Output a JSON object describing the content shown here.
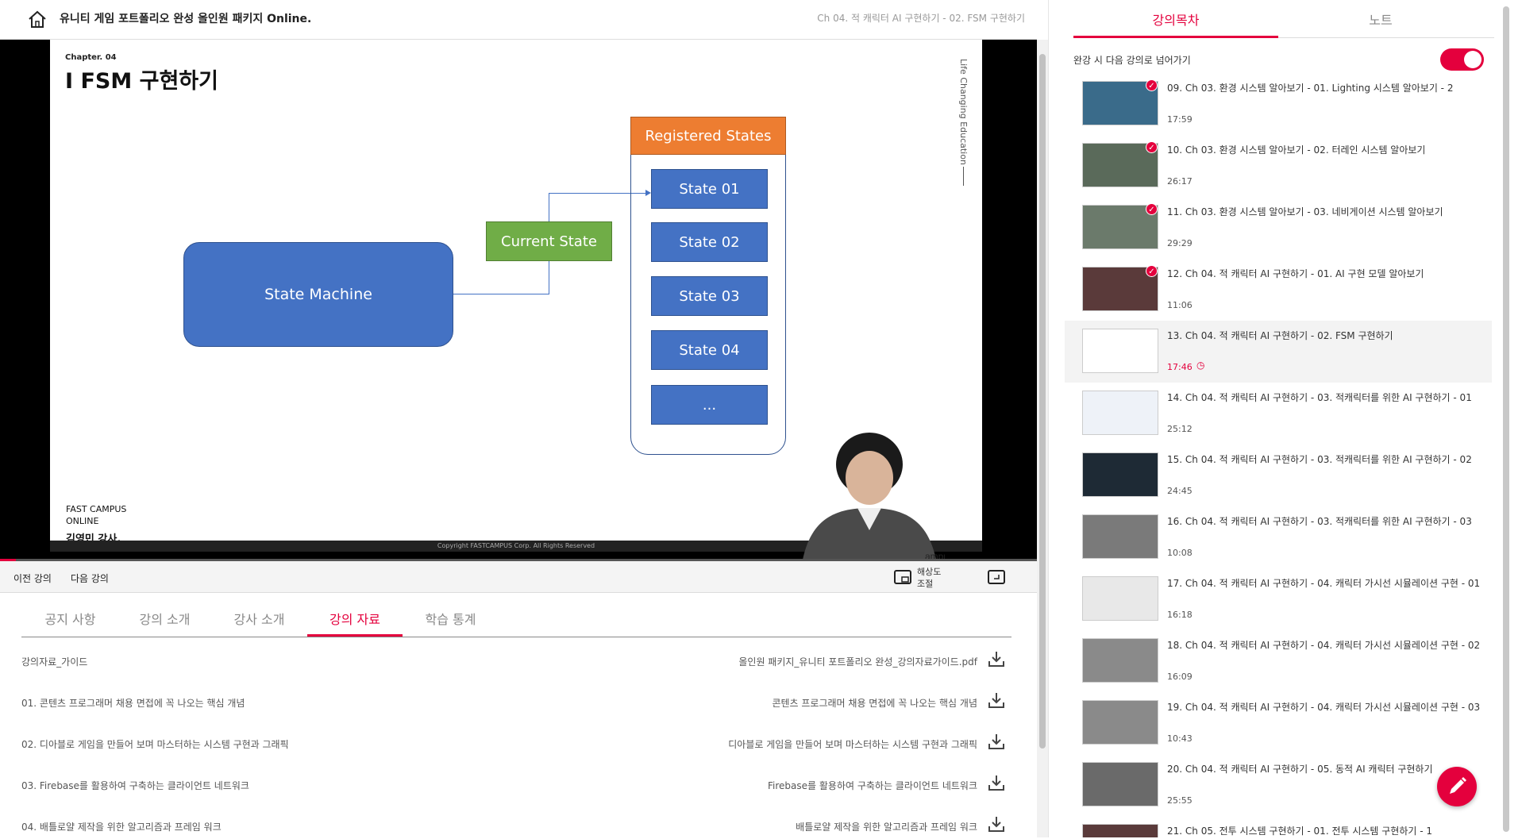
{
  "header": {
    "course_title": "유니티 게임 포트폴리오 완성 올인원 패키지 Online.",
    "breadcrumb": "Ch 04. 적 캐릭터 AI 구현하기 - 02. FSM 구현하기"
  },
  "slide": {
    "chapter": "Chapter.   04",
    "title": "I FSM 구현하기",
    "vertical_text": "Life Changing Education",
    "logo_line1": "FAST CAMPUS",
    "logo_line2": "ONLINE",
    "instructor": "김영민 강사.",
    "copyright": "Copyright FASTCAMPUS Corp. All Rights Reserved",
    "diagram": {
      "state_machine": "State Machine",
      "current_state": "Current State",
      "registered_states": "Registered States",
      "states": [
        "State 01",
        "State 02",
        "State 03",
        "State 04",
        "..."
      ]
    },
    "watermark": "fast campus"
  },
  "controls": {
    "prev": "이전 강의",
    "next": "다음 강의",
    "resolution": "해상도 조절",
    "resolution_line1": "해상도",
    "resolution_line2": "조절"
  },
  "tabs": [
    "공지 사항",
    "강의 소개",
    "강사 소개",
    "강의 자료",
    "학습 통계"
  ],
  "active_tab": "강의 자료",
  "materials": [
    {
      "left": "강의자료_가이드",
      "right": "올인원 패키지_유니티 포트폴리오 완성_강의자료가이드.pdf"
    },
    {
      "left": "01. 콘텐츠 프로그래머 채용 면접에 꼭 나오는 핵심 개념",
      "right": "콘텐츠 프로그래머 채용 면접에 꼭 나오는 핵심 개념"
    },
    {
      "left": "02. 디아블로 게임을 만들어 보며 마스터하는 시스템 구현과 그래픽",
      "right": "디아블로 게임을 만들어 보며 마스터하는 시스템 구현과 그래픽"
    },
    {
      "left": "03. Firebase를 활용하여 구축하는 클라이언트 네트워크",
      "right": "Firebase를 활용하여 구축하는 클라이언트 네트워크"
    },
    {
      "left": "04. 배틀로얄 제작을 위한 알고리즘과 프레임 워크",
      "right": "배틀로얄 제작을 위한 알고리즘과 프레임 워크"
    }
  ],
  "sidebar": {
    "tabs": [
      "강의목차",
      "노트"
    ],
    "auto_next_label": "완강 시 다음 강의로 넘어가기",
    "auto_next_on": true,
    "lectures": [
      {
        "title": "09. Ch 03. 환경 시스템 알아보기 - 01. Lighting 시스템 알아보기 - 2",
        "time": "17:59",
        "done": true
      },
      {
        "title": "10. Ch 03. 환경 시스템 알아보기 - 02. 터레인 시스템 알아보기",
        "time": "26:17",
        "done": true
      },
      {
        "title": "11. Ch 03. 환경 시스템 알아보기 - 03. 네비게이션 시스템 알아보기",
        "time": "29:29",
        "done": true
      },
      {
        "title": "12. Ch 04. 적 캐릭터 AI 구현하기 - 01. AI 구현 모델 알아보기",
        "time": "11:06",
        "done": true
      },
      {
        "title": "13. Ch 04. 적 캐릭터 AI 구현하기 - 02. FSM 구현하기",
        "time": "17:46",
        "done": false,
        "current": true
      },
      {
        "title": "14. Ch 04. 적 캐릭터 AI 구현하기 - 03. 적캐릭터를 위한 AI 구현하기 - 01",
        "time": "25:12",
        "done": false
      },
      {
        "title": "15. Ch 04. 적 캐릭터 AI 구현하기 - 03. 적캐릭터를 위한 AI 구현하기 - 02",
        "time": "24:45",
        "done": false
      },
      {
        "title": "16. Ch 04. 적 캐릭터 AI 구현하기 - 03. 적캐릭터를 위한 AI 구현하기 - 03",
        "time": "10:08",
        "done": false
      },
      {
        "title": "17. Ch 04. 적 캐릭터 AI 구현하기 - 04. 캐릭터 가시선 시뮬레이션 구현 - 01",
        "time": "16:18",
        "done": false
      },
      {
        "title": "18. Ch 04. 적 캐릭터 AI 구현하기 - 04. 캐릭터 가시선 시뮬레이션 구현 - 02",
        "time": "16:09",
        "done": false
      },
      {
        "title": "19. Ch 04. 적 캐릭터 AI 구현하기 - 04. 캐릭터 가시선 시뮬레이션 구현 - 03",
        "time": "10:43",
        "done": false
      },
      {
        "title": "20. Ch 04. 적 캐릭터 AI 구현하기 - 05. 동적 AI 캐릭터 구현하기",
        "time": "25:55",
        "done": false
      },
      {
        "title": "21. Ch 05. 전투 시스템 구현하기 - 01. 전투 시스템 구현하기 - 1",
        "time": "",
        "done": false
      }
    ]
  },
  "colors": {
    "accent": "#e4003d",
    "blue": "#4472c4",
    "green": "#70ad47",
    "orange": "#ed7d31"
  },
  "icons": {
    "home": "home-icon",
    "download": "download-icon",
    "pip": "pip-icon",
    "resolution": "resolution-icon",
    "pencil": "pencil-icon",
    "check": "check-icon",
    "clock": "clock-icon"
  }
}
